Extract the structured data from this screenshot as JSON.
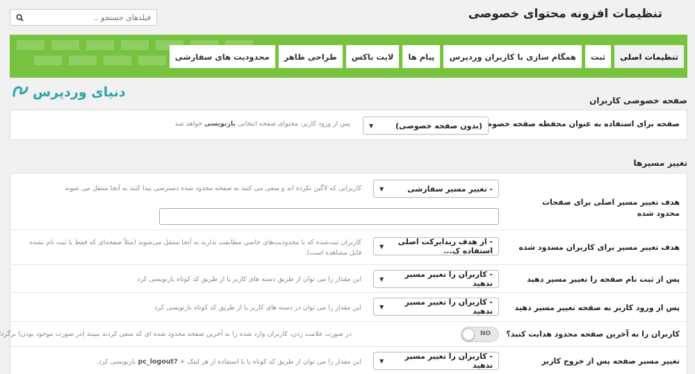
{
  "header": {
    "title": "تنظیمات افزونه محتوای خصوصی",
    "search_placeholder": "فیلدهای جستجو ..",
    "search_icon": "search-icon"
  },
  "colors": {
    "accent_green": "#77c33f",
    "logo_teal": "#2aa6a3"
  },
  "tabs": [
    {
      "label": "تنظیمات اصلی",
      "active": true
    },
    {
      "label": "ثبت"
    },
    {
      "label": "همگام سازی با کاربران وردپرس"
    },
    {
      "label": "پیام ها"
    },
    {
      "label": "لایت باکس"
    },
    {
      "label": "طراحی ظاهر"
    },
    {
      "label": "محدودیت های سفارشی"
    }
  ],
  "logo": {
    "text": "دنیای وردپرس"
  },
  "private_page": {
    "section_title": "صفحه خصوصی کاربران",
    "row_label": "صفحه برای استفاده به عنوان محفظه صفحه خصوصی کاربران",
    "select_value": "(بدون صفحه خصوصی)",
    "help_before": "پس از ورود کاربر، محتوای صفحه انتخابی ",
    "help_bold": "بازنویسی",
    "help_after": " خواهد شد"
  },
  "redirects": {
    "section_title": "تغییر مسیرها",
    "rows": [
      {
        "label": "هدف تغییر مسیر اصلی برای صفحات محدود شده",
        "select": "- تغییر مسیر سفارشی",
        "help": "کاربرانی که لاگین نکرده اند و سعی می کنند به صفحه محدود شده دسترسی پیدا کنند به آنجا منتقل می شوند",
        "input_value": ""
      },
      {
        "label": "هدف تغییر مسیر برای کاربران مسدود شده",
        "select": "- از هدف ریدایرکت اصلی استفاده ک...",
        "help": "کاربران ثبت‌شده که با محدودیت‌های خاصی مطابقت ندارند به آنجا منتقل می‌شوند (مثلاً صفحه‌ای که فقط با ثبت نام نشده قابل مشاهده است)."
      },
      {
        "label": "پس از ثبت نام صفحه را تغییر مسیر دهید",
        "select": "- کاربران را تغییر مسیر ندهید",
        "help": "این مقدار را می توان از طریق دسته های کاربر یا از طریق کد کوتاه بازنویسی کرد"
      },
      {
        "label": "پس از ورود کاربر به صفحه تغییر مسیر دهید",
        "select": "- کاربران را تغییر مسیر ندهید",
        "help": "این مقدار را می توان در دسته های کاربر یا از طریق کد کوتاه بازنویسی کرد"
      },
      {
        "label": "کاربران را به آخرین صفحه محدود هدایت کنید؟",
        "toggle": "NO",
        "help": "در صورت علامت زدن، کاربران وارد شده را به آخرین صفحه محدود شده ای که سعی کردند ببینند (در صورت موجود بودن) برگردانید."
      },
      {
        "label": "تغییر مسیر صفحه پس از خروج کاربر",
        "select": "- کاربران را تغییر مسیر ندهید",
        "help_before": "این مقدار را می توان از طریق کد کوتاه یا با استفاده از هر لینک + ",
        "help_bold": "?pc_logout",
        "help_after": " بازنویسی کرد."
      }
    ]
  }
}
